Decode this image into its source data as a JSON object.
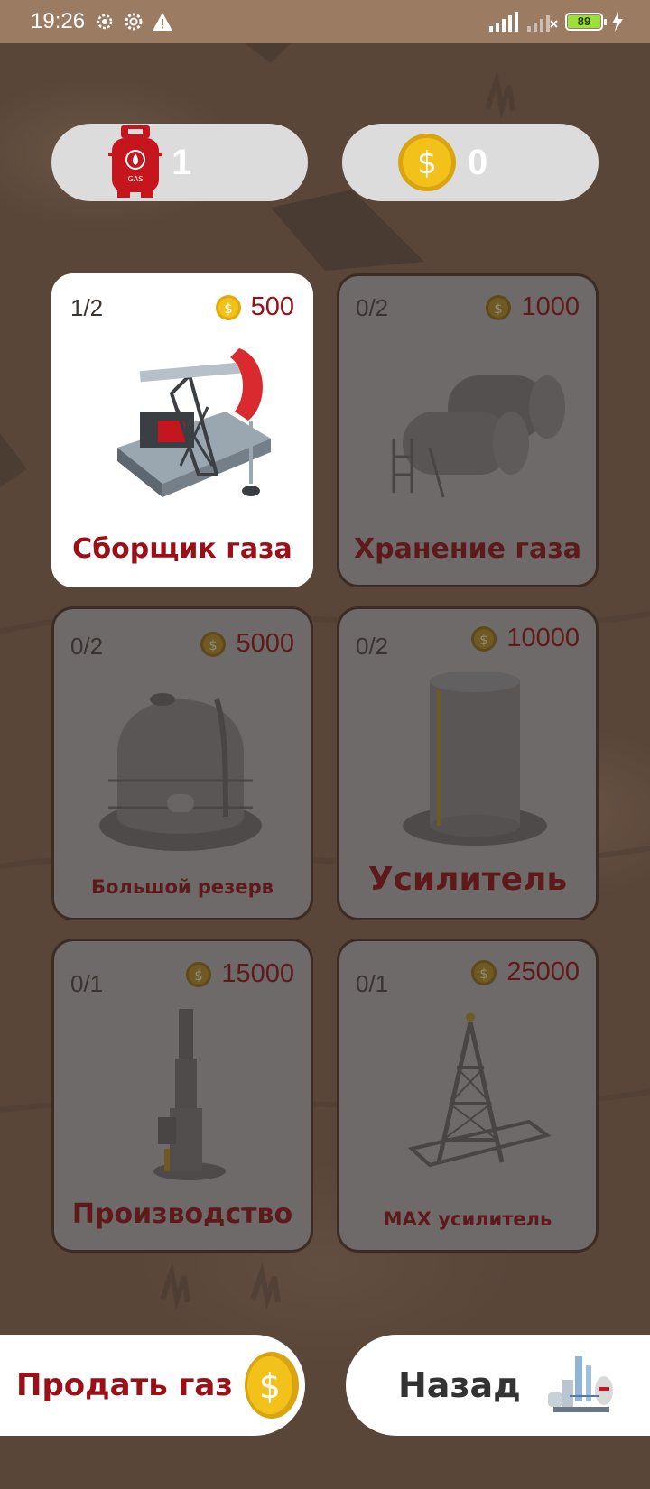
{
  "status_bar": {
    "time": "19:26",
    "battery": "89"
  },
  "resources": {
    "gas_count": "1",
    "gas_icon_label": "GAS",
    "coins": "0"
  },
  "cards": [
    {
      "level": "1/2",
      "price": "500",
      "title": "Сборщик газа",
      "state": "unlocked"
    },
    {
      "level": "0/2",
      "price": "1000",
      "title": "Хранение газа",
      "state": "locked"
    },
    {
      "level": "0/2",
      "price": "5000",
      "title": "Большой резерв",
      "state": "locked"
    },
    {
      "level": "0/2",
      "price": "10000",
      "title": "Усилитель",
      "state": "locked"
    },
    {
      "level": "0/1",
      "price": "15000",
      "title": "Производство",
      "state": "locked"
    },
    {
      "level": "0/1",
      "price": "25000",
      "title": "MAX усилитель",
      "state": "locked"
    }
  ],
  "buttons": {
    "sell_label": "Продать газ",
    "back_label": "Назад"
  },
  "colors": {
    "accent_red": "#9b0f17",
    "coin_gold": "#f2c21b",
    "status_bar": "#9c7b63"
  }
}
